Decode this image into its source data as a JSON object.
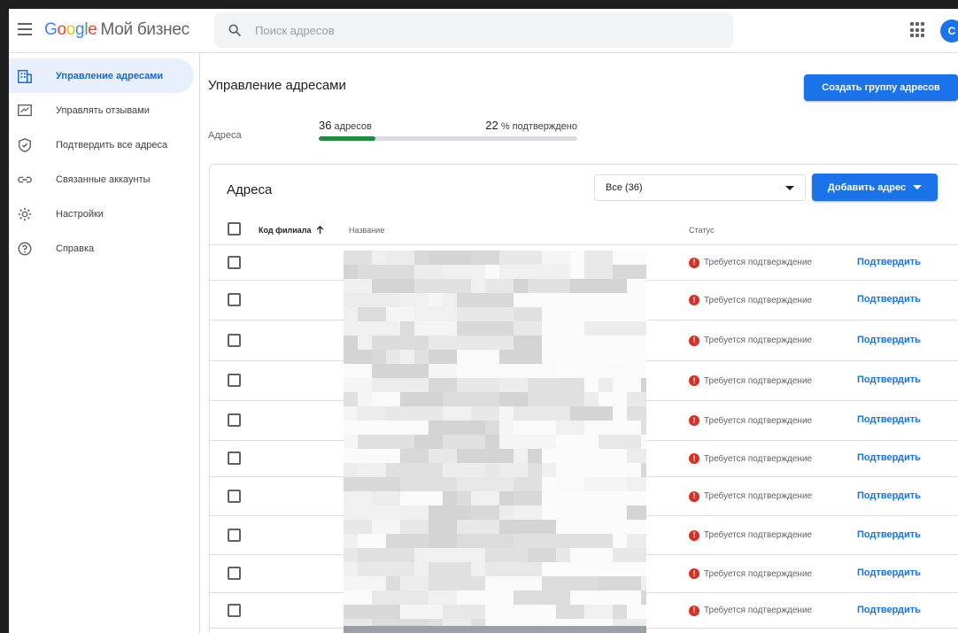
{
  "topbar": {
    "logo_google": "Google",
    "logo_product": "Мой бизнес",
    "search_placeholder": "Поиск адресов",
    "avatar_letter": "C"
  },
  "sidebar": {
    "items": [
      {
        "label": "Управление адресами",
        "icon": "building-icon",
        "active": true
      },
      {
        "label": "Управлять отзывами",
        "icon": "review-icon",
        "active": false
      },
      {
        "label": "Подтвердить все адреса",
        "icon": "shield-check-icon",
        "active": false
      },
      {
        "label": "Связанные аккаунты",
        "icon": "link-icon",
        "active": false
      },
      {
        "label": "Настройки",
        "icon": "gear-icon",
        "active": false
      },
      {
        "label": "Справка",
        "icon": "help-icon",
        "active": false
      }
    ]
  },
  "main": {
    "title": "Управление адресами",
    "create_group_label": "Создать группу адресов",
    "stats": {
      "label": "Адреса",
      "count_number": "36",
      "count_suffix": "адресов",
      "verified_number": "22",
      "verified_suffix": "% подтверждено",
      "verified_fraction": 0.22
    }
  },
  "card": {
    "title": "Адреса",
    "filter_value": "Все (36)",
    "add_label": "Добавить адрес",
    "columns": {
      "code": "Код филиала",
      "name": "Название",
      "status": "Статус"
    },
    "rows": [
      {
        "status": "Требуется подтверждение",
        "action": "Подтвердить"
      },
      {
        "status": "Требуется подтверждение",
        "action": "Подтвердить"
      },
      {
        "status": "Требуется подтверждение",
        "action": "Подтвердить"
      },
      {
        "status": "Требуется подтверждение",
        "action": "Подтвердить"
      },
      {
        "status": "Требуется подтверждение",
        "action": "Подтвердить"
      },
      {
        "status": "Требуется подтверждение",
        "action": "Подтвердить"
      },
      {
        "status": "Требуется подтверждение",
        "action": "Подтвердить"
      },
      {
        "status": "Требуется подтверждение",
        "action": "Подтвердить"
      },
      {
        "status": "Требуется подтверждение",
        "action": "Подтвердить"
      },
      {
        "status": "Требуется подтверждение",
        "action": "Подтвердить"
      }
    ]
  },
  "colors": {
    "accent": "#1a73e8",
    "progress": "#1e8e3e",
    "error": "#d93025",
    "active_nav_bg": "#e8f0fe"
  }
}
